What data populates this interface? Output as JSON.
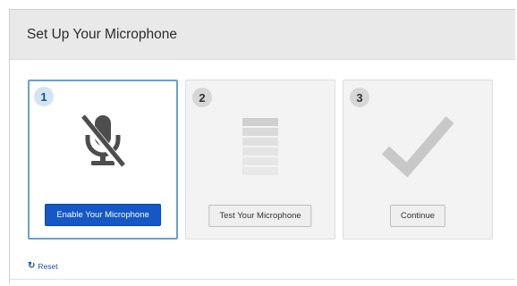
{
  "header": {
    "title": "Set Up Your Microphone"
  },
  "steps": [
    {
      "number": "1",
      "button_label": "Enable Your Microphone",
      "icon": "microphone-muted-icon"
    },
    {
      "number": "2",
      "button_label": "Test Your Microphone",
      "icon": "level-meter-icon"
    },
    {
      "number": "3",
      "button_label": "Continue",
      "icon": "checkmark-icon"
    }
  ],
  "footer": {
    "reset_label": "Reset",
    "reset_icon": "refresh-icon"
  },
  "colors": {
    "primary_button": "#1557c4",
    "active_border": "#6a9fd6",
    "link": "#1a4f9e",
    "header_bg": "#e9e9e9"
  }
}
